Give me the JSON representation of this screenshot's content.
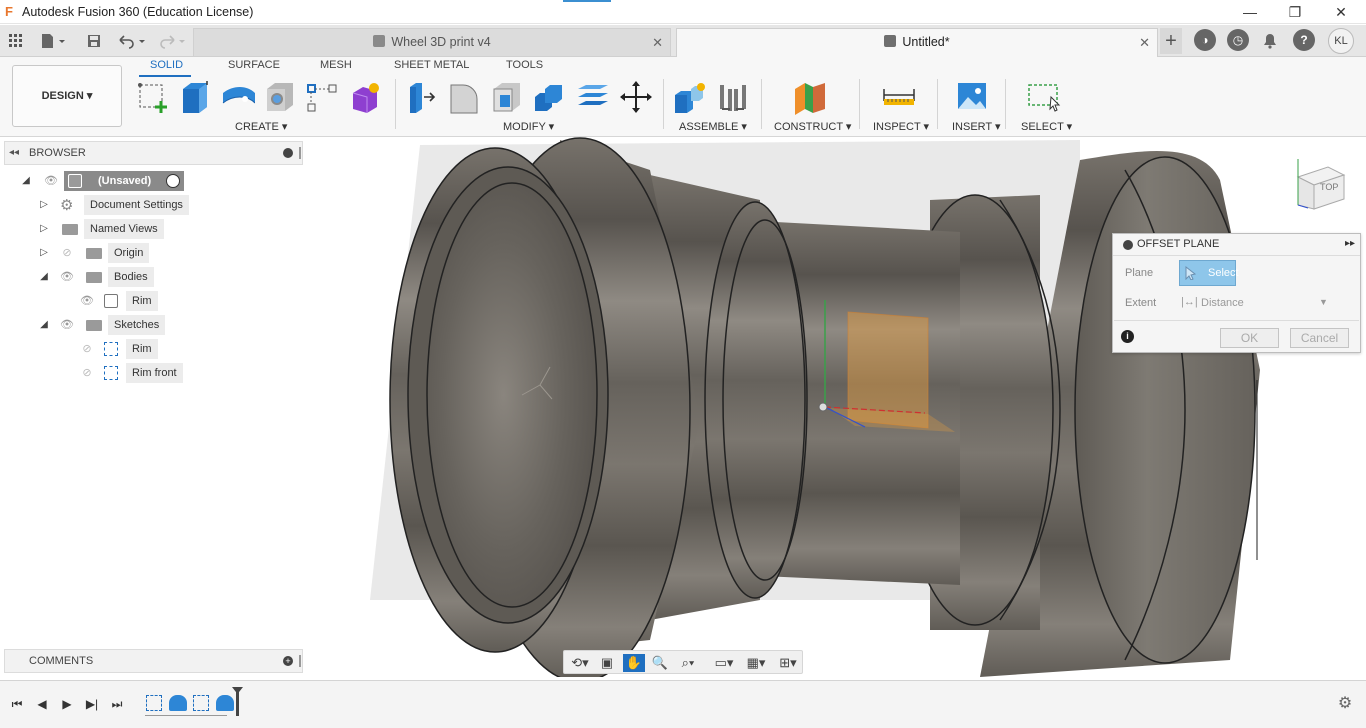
{
  "window": {
    "title": "Autodesk Fusion 360 (Education License)",
    "controls": {
      "minimize": "—",
      "restore": "❐",
      "close": "✕"
    }
  },
  "tabs": [
    {
      "label": "Wheel 3D print v4",
      "close": "✕"
    },
    {
      "label": "Untitled*",
      "close": "✕"
    }
  ],
  "tabbar_right": {
    "add": "+",
    "user_initials": "KL"
  },
  "workspace": {
    "label": "DESIGN ▾"
  },
  "ribbon_tabs": [
    "SOLID",
    "SURFACE",
    "MESH",
    "SHEET METAL",
    "TOOLS"
  ],
  "tool_groups": {
    "create": "CREATE ▾",
    "modify": "MODIFY ▾",
    "assemble": "ASSEMBLE ▾",
    "construct": "CONSTRUCT ▾",
    "inspect": "INSPECT ▾",
    "insert": "INSERT ▾",
    "select": "SELECT ▾"
  },
  "browser": {
    "title": "BROWSER",
    "root": "(Unsaved)",
    "items": [
      {
        "label": "Document Settings"
      },
      {
        "label": "Named Views"
      },
      {
        "label": "Origin"
      },
      {
        "label": "Bodies"
      },
      {
        "label": "Rim"
      },
      {
        "label": "Sketches"
      },
      {
        "label": "Rim"
      },
      {
        "label": "Rim front"
      }
    ]
  },
  "viewcube": {
    "face": "TOP"
  },
  "offset_plane": {
    "title": "OFFSET PLANE",
    "plane_label": "Plane",
    "select_button": "Select",
    "extent_label": "Extent",
    "extent_value": "Distance",
    "ok": "OK",
    "cancel": "Cancel"
  },
  "comments": {
    "title": "COMMENTS"
  },
  "colors": {
    "accent": "#1f6fc0",
    "model_gray": "#6e6a64",
    "plane_orange": "#e8a040",
    "select_button_blue": "#8ec6ea"
  }
}
